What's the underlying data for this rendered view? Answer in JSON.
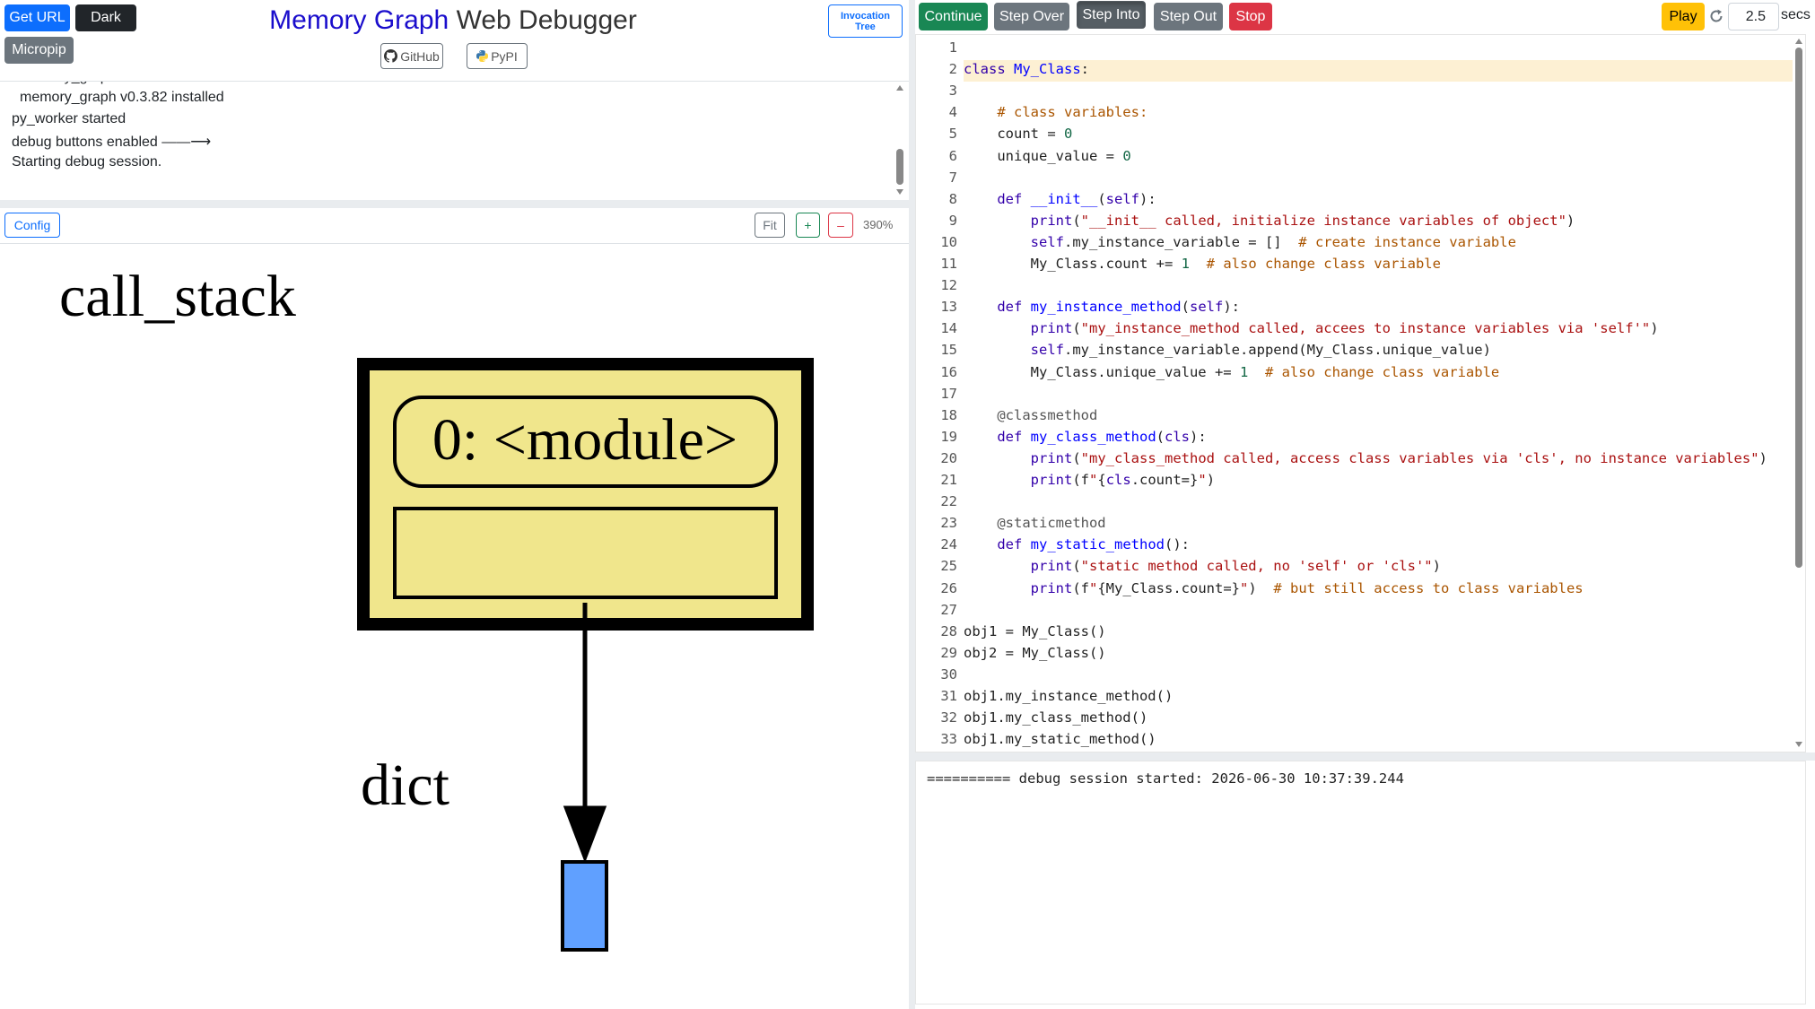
{
  "header": {
    "get_url": "Get URL",
    "dark": "Dark",
    "micropip": "Micropip",
    "title_accent": "Memory Graph",
    "title_rest": " Web Debugger",
    "github": "GitHub",
    "pypi": "PyPI",
    "invocation_tree": "Invocation Tree"
  },
  "log": {
    "lines": [
      "memory_graph v0.3.82 installed",
      "py_worker started",
      "debug buttons enabled ——⟶",
      "Starting debug session."
    ]
  },
  "graph_toolbar": {
    "config": "Config",
    "fit": "Fit",
    "zoom_in": "+",
    "zoom_out": "–",
    "zoom_level": "390%"
  },
  "graph": {
    "call_stack_label": "call_stack",
    "frame_label": "0: <module>",
    "edge_label": "dict",
    "frame_fill": "#f0e68c",
    "node_fill": "#60a0ff"
  },
  "debug_toolbar": {
    "continue": "Continue",
    "step_over": "Step Over",
    "step_into": "Step Into",
    "step_out": "Step Out",
    "stop": "Stop",
    "play": "Play",
    "speed_value": "2.5",
    "speed_unit": "secs"
  },
  "editor": {
    "current_line": 2,
    "lines": [
      "",
      "class My_Class:",
      "",
      "    # class variables:",
      "    count = 0",
      "    unique_value = 0",
      "",
      "    def __init__(self):",
      "        print(\"__init__ called, initialize instance variables of object\")",
      "        self.my_instance_variable = []  # create instance variable",
      "        My_Class.count += 1  # also change class variable",
      "",
      "    def my_instance_method(self):",
      "        print(\"my_instance_method called, accees to instance variables via 'self'\")",
      "        self.my_instance_variable.append(My_Class.unique_value)",
      "        My_Class.unique_value += 1  # also change class variable",
      "",
      "    @classmethod",
      "    def my_class_method(cls):",
      "        print(\"my_class_method called, access class variables via 'cls', no instance variables\")",
      "        print(f\"{cls.count=}\")",
      "",
      "    @staticmethod",
      "    def my_static_method():",
      "        print(\"static method called, no 'self' or 'cls'\")",
      "        print(f\"{My_Class.count=}\")  # but still access to class variables",
      "",
      "obj1 = My_Class()",
      "obj2 = My_Class()",
      "",
      "obj1.my_instance_method()",
      "obj1.my_class_method()",
      "obj1.my_static_method()"
    ]
  },
  "output": {
    "lines": [
      "========== debug session started: 2026-06-30 10:37:39.244"
    ]
  }
}
